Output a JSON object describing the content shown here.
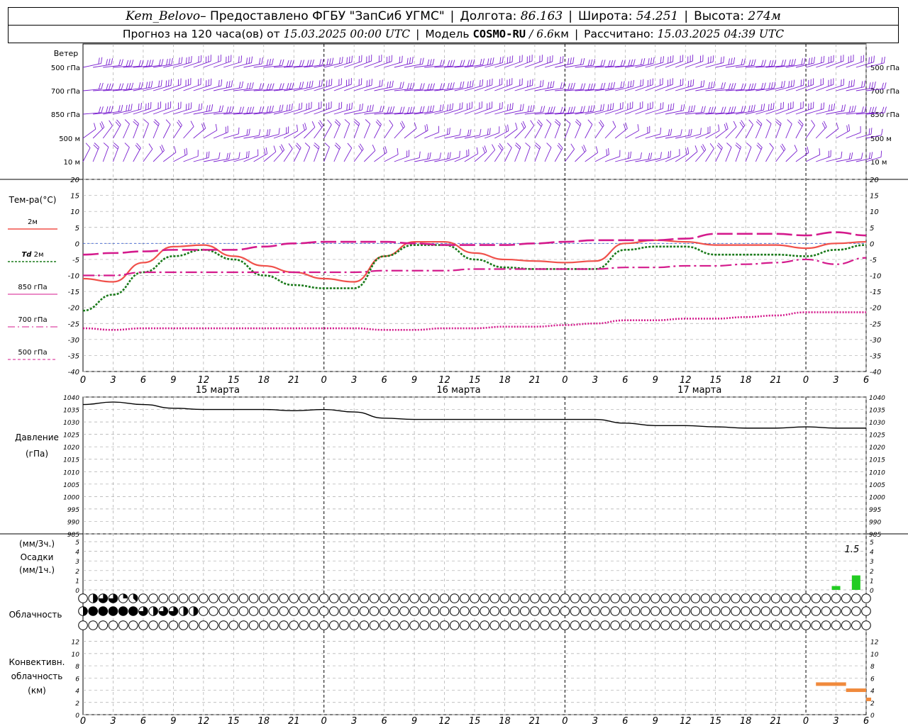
{
  "header": {
    "station": "Kem_Belovo",
    "provider": " – Предоставлено ФГБУ \"ЗапСиб УГМС\"",
    "lon_label": "Долгота:",
    "lon_value": "86.163",
    "lat_label": "Широта:",
    "lat_value": "54.251",
    "alt_label": "Высота:",
    "alt_value": "274м",
    "forecast_prefix": "Прогноз на 120 часа(ов)  от",
    "forecast_time": "15.03.2025 00:00 UTC",
    "model_label": "Модель",
    "model_name": "COSMO-RU",
    "model_res": "/ 6.6",
    "model_unit": "км",
    "computed_label": "Рассчитано:",
    "computed_time": "15.03.2025 04:39 UTC"
  },
  "colors": {
    "wind": "#7a1fd0",
    "t2m": "#f0504a",
    "td": "#1a7a1a",
    "t850": "#d41a8c",
    "t500": "#d41a8c",
    "pressure": "#000000",
    "precip": "#22cc22",
    "conv": "#f08a3c",
    "grid": "#aaaaaa"
  },
  "time_axis": {
    "ticks": [
      "0",
      "3",
      "6",
      "9",
      "12",
      "15",
      "18",
      "21",
      "0",
      "3",
      "6",
      "9",
      "12",
      "15",
      "18",
      "21",
      "0",
      "3",
      "6",
      "9",
      "12",
      "15",
      "18",
      "21",
      "0",
      "3",
      "6"
    ],
    "days": [
      "15 марта",
      "16 марта",
      "17 марта"
    ]
  },
  "wind_panel": {
    "title": "Ветер",
    "levels": [
      "500 гПа",
      "700 гПа",
      "850 гПа",
      "500 м",
      "10  м"
    ]
  },
  "temp_panel": {
    "title": "Тем-ра(°С)",
    "ticks": [
      "20",
      "15",
      "10",
      "5",
      "0",
      "-5",
      "-10",
      "-15",
      "-20",
      "-25",
      "-30",
      "-35",
      "-40"
    ],
    "legend": [
      {
        "label": "2м",
        "italic": ""
      },
      {
        "label": " 2м",
        "italic": "Td"
      },
      {
        "label": "850 гПа",
        "italic": ""
      },
      {
        "label": "700 гПа",
        "italic": ""
      },
      {
        "label": "500 гПа",
        "italic": ""
      }
    ]
  },
  "pressure_panel": {
    "title": "Давление",
    "unit": "(гПа)",
    "ticks": [
      "1040",
      "1035",
      "1030",
      "1025",
      "1020",
      "1015",
      "1010",
      "1005",
      "1000",
      "995",
      "990",
      "985"
    ]
  },
  "precip_panel": {
    "unit3": "(мм/3ч.)",
    "title": "Осадки",
    "unit1": "(мм/1ч.)",
    "ticks": [
      "5",
      "4",
      "3",
      "2",
      "1",
      "0",
      "5",
      "4",
      "3",
      "2",
      "1",
      "0"
    ],
    "max_label": "1.5"
  },
  "cloud_panel": {
    "title": "Облачность"
  },
  "conv_panel": {
    "title1": "Конвективн.",
    "title2": "облачность",
    "unit": "(км)",
    "ticks": [
      "12",
      "10",
      "8",
      "6",
      "4",
      "2",
      "0"
    ]
  },
  "chart_data": {
    "type": "line",
    "x_hours": [
      0,
      3,
      6,
      9,
      12,
      15,
      18,
      21,
      24,
      27,
      30,
      33,
      36,
      39,
      42,
      45,
      48,
      51,
      54,
      57,
      60,
      63,
      66,
      69,
      72,
      75,
      78
    ],
    "series": [
      {
        "name": "2м",
        "values": [
          -11,
          -12,
          -6,
          -1,
          -0.5,
          -4,
          -7,
          -9,
          -11,
          -12,
          -4,
          0.5,
          0.5,
          -3,
          -5,
          -5.5,
          -6,
          -5.5,
          0,
          1,
          0.5,
          -0.5,
          -0.5,
          -0.5,
          -1.5,
          0,
          0.5
        ]
      },
      {
        "name": "Td 2м",
        "values": [
          -21,
          -16,
          -9,
          -4,
          -2,
          -5,
          -10,
          -13,
          -14,
          -14,
          -4,
          -0.5,
          -0.5,
          -5,
          -7.5,
          -8,
          -8,
          -8,
          -2,
          -1,
          -1,
          -3.5,
          -3.5,
          -3.5,
          -4,
          -2,
          -0.5
        ]
      },
      {
        "name": "850 гПа",
        "values": [
          -3.5,
          -3,
          -2.5,
          -2,
          -2,
          -2,
          -1,
          0,
          0.5,
          0.5,
          0.5,
          0,
          -0.5,
          -0.5,
          -0.5,
          0,
          0.5,
          1,
          1,
          1,
          1.5,
          3,
          3,
          3,
          2.5,
          3.5,
          2.5
        ]
      },
      {
        "name": "700 гПа",
        "values": [
          -10,
          -10,
          -9,
          -9,
          -9,
          -9,
          -9,
          -9,
          -9,
          -9,
          -8.5,
          -8.5,
          -8.5,
          -8,
          -8,
          -8,
          -8,
          -8,
          -7.5,
          -7.5,
          -7,
          -7,
          -6.5,
          -6,
          -5,
          -6.5,
          -4.5
        ]
      },
      {
        "name": "500 гПа",
        "values": [
          -26.5,
          -27,
          -26.5,
          -26.5,
          -26.5,
          -26.5,
          -26.5,
          -26.5,
          -26.5,
          -26.5,
          -27,
          -27,
          -26.5,
          -26.5,
          -26,
          -26,
          -25.5,
          -25,
          -24,
          -24,
          -23.5,
          -23.5,
          -23,
          -22.5,
          -21.5,
          -21.5,
          -21.5
        ]
      },
      {
        "name": "Давление",
        "values": [
          1037,
          1038,
          1037,
          1035.5,
          1035,
          1035,
          1035,
          1034.5,
          1035,
          1034,
          1031.5,
          1031,
          1031,
          1031,
          1031,
          1031,
          1031,
          1031,
          1029.5,
          1028.5,
          1028.5,
          1028,
          1027.5,
          1027.5,
          1028,
          1027.5,
          1027.5
        ]
      }
    ],
    "temp_ylim": [
      -40,
      20
    ],
    "pressure_ylim": [
      985,
      1040
    ],
    "precip": {
      "hours": [
        75,
        77
      ],
      "values": [
        0.4,
        1.5
      ],
      "ylim": [
        0,
        5
      ]
    },
    "conv_cloud": [
      {
        "start": 73,
        "end": 76,
        "top": 5
      },
      {
        "start": 76,
        "end": 78,
        "top": 4
      },
      {
        "start": 78,
        "end": 78.5,
        "top": 2.5
      }
    ],
    "conv_ylim": [
      0,
      13
    ],
    "cloud_cover": {
      "high": [
        0,
        4,
        6,
        6,
        2,
        3,
        0,
        0,
        0,
        0,
        0,
        0,
        0,
        0,
        0,
        0,
        0,
        0,
        0,
        0,
        0,
        0,
        0,
        0,
        0,
        0,
        0,
        0,
        0,
        0,
        0,
        0,
        0,
        0,
        0,
        0,
        0,
        0,
        0,
        0,
        0,
        0,
        0,
        0,
        0,
        0,
        0,
        0,
        0,
        0,
        0,
        0,
        0,
        0,
        0,
        0,
        0,
        0,
        0,
        0,
        0,
        0,
        0,
        0,
        0,
        0,
        0,
        0,
        0,
        0,
        0,
        0,
        0,
        0,
        0,
        0,
        0,
        0,
        0,
        0,
        0,
        0,
        0,
        0,
        0,
        0,
        0,
        0,
        0,
        0,
        0,
        0,
        0,
        0,
        0,
        0,
        0,
        0,
        0,
        0,
        0,
        0,
        0,
        0,
        0,
        0,
        0,
        0,
        0,
        0,
        0,
        0,
        0,
        0,
        0,
        0,
        0,
        0,
        0,
        0,
        0,
        0,
        0,
        0,
        0,
        0,
        0,
        0,
        0,
        0
      ],
      "mid": [
        4,
        8,
        8,
        8,
        8,
        8,
        6,
        4,
        6,
        6,
        4,
        4,
        0,
        0,
        0,
        0,
        0,
        0,
        0,
        0,
        0,
        0,
        0,
        0,
        0,
        0,
        0,
        0,
        0,
        0,
        0,
        0,
        0,
        0,
        0,
        0,
        0,
        0,
        0,
        0,
        0,
        0,
        0,
        0,
        0,
        0,
        0,
        0,
        0,
        0,
        0,
        0,
        0,
        0,
        0,
        0,
        0,
        0,
        0,
        0,
        0,
        0,
        0,
        0,
        0,
        0,
        0,
        0,
        0,
        0,
        0,
        0,
        0,
        0,
        0,
        0,
        0,
        0,
        0,
        0,
        0,
        0,
        0,
        0,
        0,
        0,
        0,
        0,
        0,
        0,
        0,
        0,
        0,
        0,
        0,
        0,
        0,
        0,
        0,
        0,
        0,
        0,
        0,
        0,
        0,
        0,
        0,
        0,
        0,
        0,
        0,
        0,
        0,
        0,
        0,
        0,
        0,
        0,
        0,
        0,
        0,
        0,
        0,
        0,
        0,
        0,
        0,
        0,
        0,
        0
      ],
      "low": [
        0,
        0,
        0,
        0,
        0,
        0,
        0,
        0,
        0,
        0,
        0,
        0,
        0,
        0,
        0,
        0,
        0,
        0,
        0,
        0,
        0,
        0,
        0,
        0,
        0,
        0,
        0,
        0,
        0,
        0,
        0,
        0,
        0,
        0,
        0,
        0,
        0,
        0,
        0,
        0,
        0,
        0,
        0,
        0,
        0,
        0,
        0,
        0,
        0,
        0,
        0,
        0,
        0,
        0,
        0,
        0,
        0,
        0,
        0,
        0,
        0,
        0,
        0,
        0,
        0,
        0,
        0,
        0,
        0,
        0,
        0,
        0,
        0,
        0,
        0,
        0,
        0,
        0,
        0,
        0,
        0,
        0,
        0,
        0,
        0,
        0,
        0,
        0,
        0,
        0,
        0,
        0,
        0,
        0,
        0,
        0,
        0,
        0,
        0,
        0,
        0,
        0,
        0,
        0,
        0,
        0,
        0,
        0,
        0,
        0,
        0,
        0,
        0,
        0,
        0,
        0,
        0,
        0,
        0,
        0,
        0,
        0,
        0,
        0,
        0,
        0,
        0,
        0,
        0,
        0
      ]
    }
  }
}
